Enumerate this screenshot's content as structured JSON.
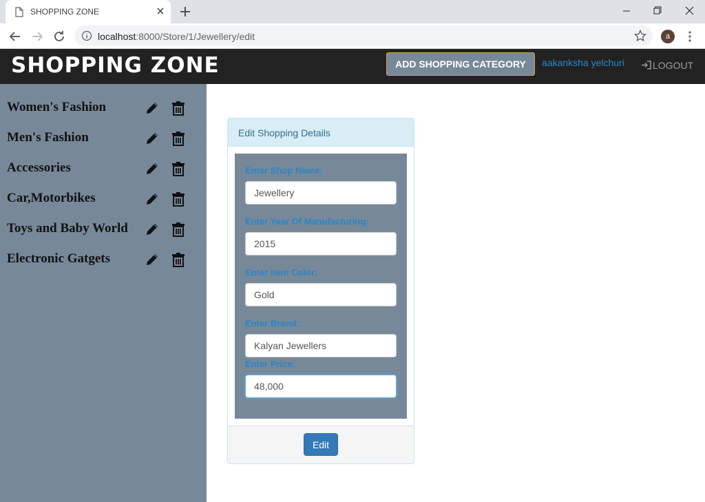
{
  "browser": {
    "tab_title": "SHOPPING ZONE",
    "url_host": "localhost",
    "url_path": ":8000/Store/1/Jewellery/edit",
    "profile_initial": "a"
  },
  "navbar": {
    "brand": "SHOPPING ZONE",
    "add_category_label": "ADD SHOPPING CATEGORY",
    "username": "aakanksha yelchuri",
    "logout_label": "LOGOUT"
  },
  "sidebar": {
    "items": [
      {
        "label": "Women's Fashion"
      },
      {
        "label": "Men's Fashion"
      },
      {
        "label": "Accessories"
      },
      {
        "label": "Car,Motorbikes"
      },
      {
        "label": "Toys and Baby World"
      },
      {
        "label": "Electronic Gatgets"
      }
    ]
  },
  "panel": {
    "title": "Edit Shopping Details",
    "fields": [
      {
        "label": "Enter Shop Name:",
        "value": "Jewellery"
      },
      {
        "label": "Enter Year Of Manufacturing:",
        "value": "2015"
      },
      {
        "label": "Enter item Color:",
        "value": "Gold"
      },
      {
        "label": "Enter Brand:",
        "value": "Kalyan Jewellers"
      },
      {
        "label": "Enter Price:",
        "value": "48,000"
      }
    ],
    "submit_label": "Edit"
  },
  "colors": {
    "sidebar_bg": "#778899",
    "navbar_bg": "#222222",
    "label_blue": "#2a86c9",
    "primary_button": "#337ab7"
  },
  "icons": {
    "category_edit": "pencil-icon",
    "category_delete": "trash-icon",
    "logout": "log-in-icon"
  }
}
